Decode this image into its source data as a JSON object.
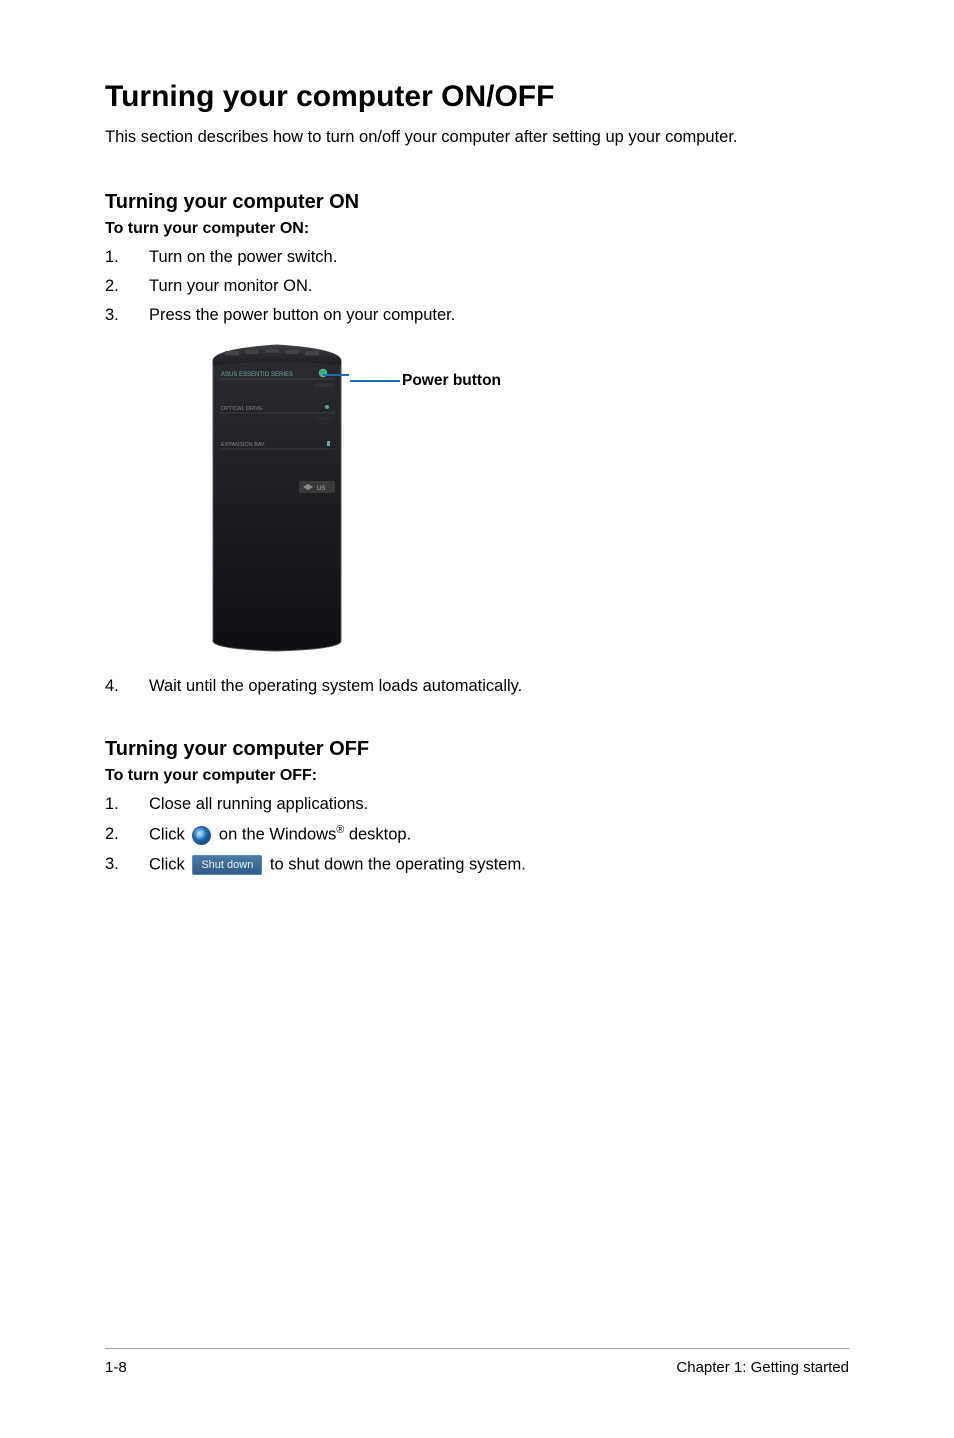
{
  "heading": "Turning your computer ON/OFF",
  "intro": "This section describes how to turn on/off your computer after setting up your computer.",
  "on": {
    "title": "Turning your computer ON",
    "bold": "To turn your computer ON:",
    "steps": [
      {
        "n": "1.",
        "t": "Turn on the power switch."
      },
      {
        "n": "2.",
        "t": "Turn your monitor ON."
      },
      {
        "n": "3.",
        "t": "Press the power button on your computer."
      }
    ],
    "callout": "Power button",
    "step4n": "4.",
    "step4t": "Wait until the operating system loads automatically."
  },
  "off": {
    "title": "Turning your computer OFF",
    "bold": "To turn your computer OFF:",
    "steps": {
      "s1n": "1.",
      "s1t": "Close all running applications.",
      "s2n": "2.",
      "s2a": "Click ",
      "s2b": " on the Windows",
      "s2c": " desktop.",
      "reg": "®",
      "s3n": "3.",
      "s3a": "Click ",
      "shutlabel": "Shut down",
      "s3b": " to shut down the operating system."
    }
  },
  "footer": {
    "left": "1-8",
    "right": "Chapter 1: Getting started"
  }
}
